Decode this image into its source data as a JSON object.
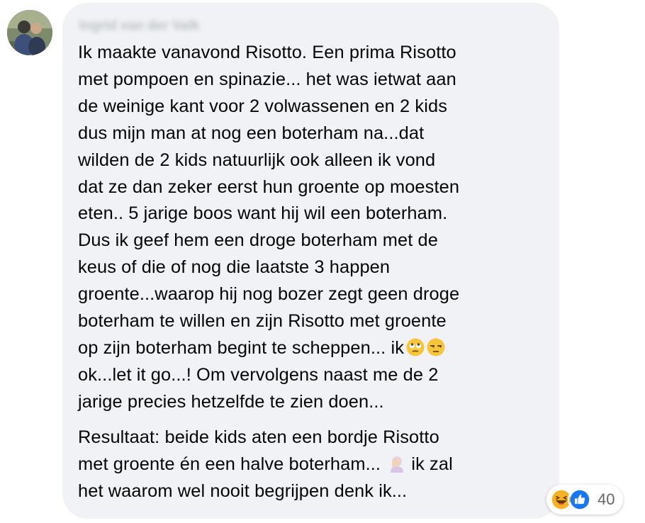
{
  "comment": {
    "author": "Ingrid van der Valk",
    "avatar_icon": "profile-photo",
    "paragraphs": [
      [
        "Ik maakte vanavond Risotto. Een prima Risotto",
        "met pompoen en spinazie... het was ietwat aan",
        "de weinige kant voor 2 volwassenen en 2 kids",
        "dus mijn man at nog een boterham na...dat",
        "wilden de 2 kids natuurlijk ook alleen ik vond",
        "dat ze dan zeker eerst hun groente op moesten",
        "eten.. 5 jarige boos want hij wil een boterham.",
        "Dus ik geef hem een droge boterham met de",
        "keus of die of nog die laatste 3 happen",
        "groente...waarop hij nog bozer zegt geen droge",
        "boterham te willen en zijn Risotto met groente",
        "op zijn boterham begint te scheppen... ik",
        "ok...let it go...! Om vervolgens naast me de 2",
        "jarige precies hetzelfde te zien doen..."
      ],
      [
        "Resultaat: beide kids aten een bordje Risotto",
        "met groente én een halve boterham...",
        "het waarom wel nooit begrijpen denk ik..."
      ]
    ],
    "line_emojis": {
      "p1_line12": [
        "face-with-rolling-eyes-emoji",
        "unamused-face-emoji"
      ],
      "p2_line2": [
        "woman-facepalming-emoji"
      ]
    },
    "p2_line2_suffix": "ik zal",
    "reactions": {
      "icons": [
        "haha-reaction-icon",
        "like-reaction-icon"
      ],
      "count": "40"
    }
  },
  "colors": {
    "bubble_bg": "#f0f2f5",
    "text": "#050505",
    "meta_text": "#65676b",
    "like_blue": "#1877f2",
    "haha_yellow": "#f7b125"
  }
}
